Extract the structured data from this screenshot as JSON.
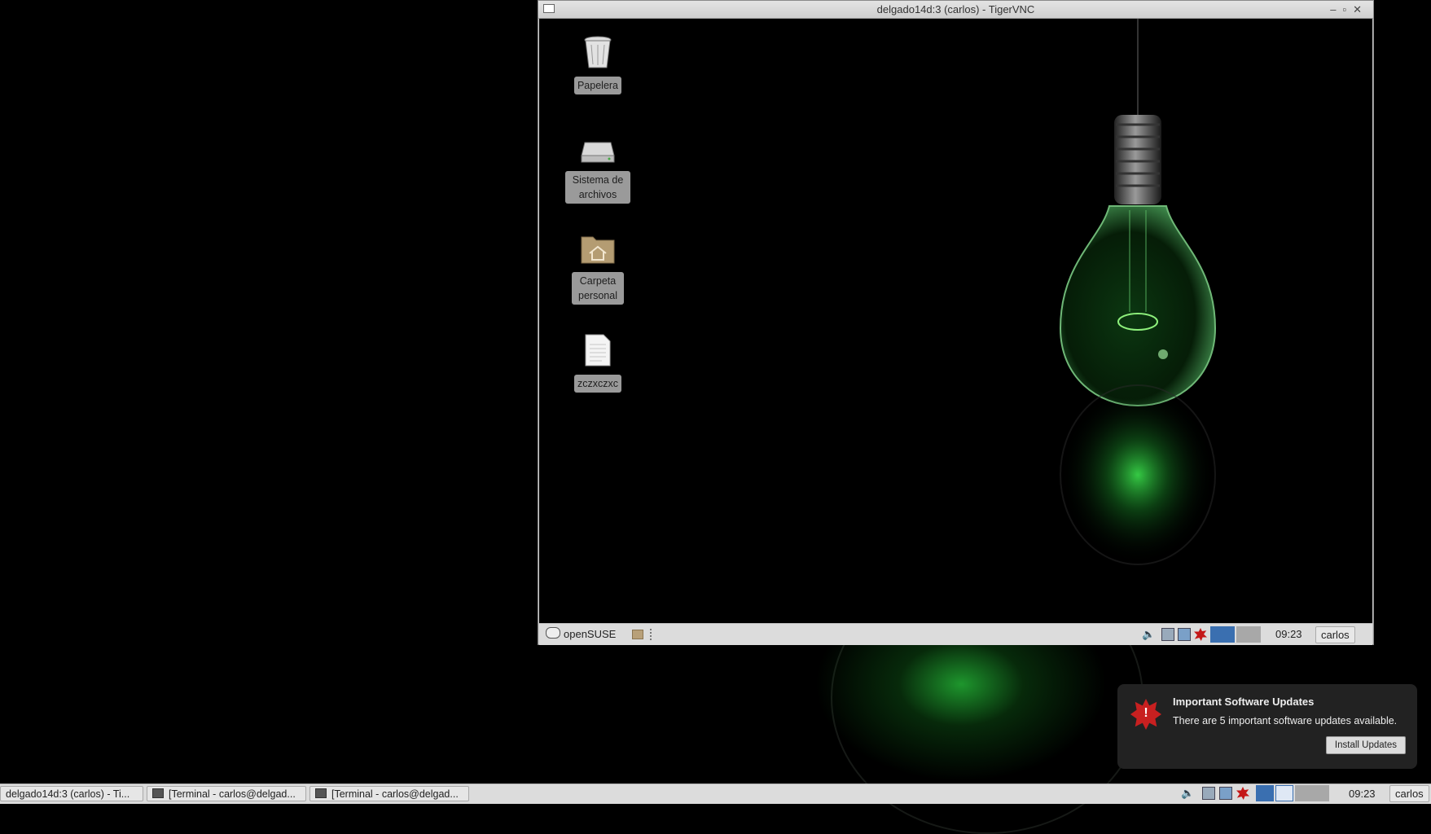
{
  "vnc_window": {
    "title": "delgado14d:3 (carlos) - TigerVNC",
    "controls": [
      "minimize-icon",
      "maximize-icon",
      "close-icon"
    ],
    "desktop_icons": [
      {
        "label": "Papelera",
        "icon": "trash-icon"
      },
      {
        "label": "Sistema de archivos",
        "icon": "drive-icon"
      },
      {
        "label": "Carpeta personal",
        "icon": "home-folder-icon"
      },
      {
        "label": "zczxczxc",
        "icon": "document-icon"
      }
    ],
    "panel": {
      "start_label": "openSUSE",
      "clock": "09:23",
      "user": "carlos"
    }
  },
  "notification": {
    "title": "Important Software Updates",
    "body": "There are 5 important software updates available.",
    "button": "Install Updates"
  },
  "taskbar": {
    "tasks": [
      {
        "label": "delgado14d:3 (carlos) - Ti..."
      },
      {
        "label": "[Terminal - carlos@delgad..."
      },
      {
        "label": "[Terminal - carlos@delgad..."
      }
    ],
    "clock": "09:23",
    "user": "carlos"
  },
  "colors": {
    "accent_green": "#2fd040",
    "alert_red": "#c82020",
    "pager_active": "#3a6fb0"
  }
}
